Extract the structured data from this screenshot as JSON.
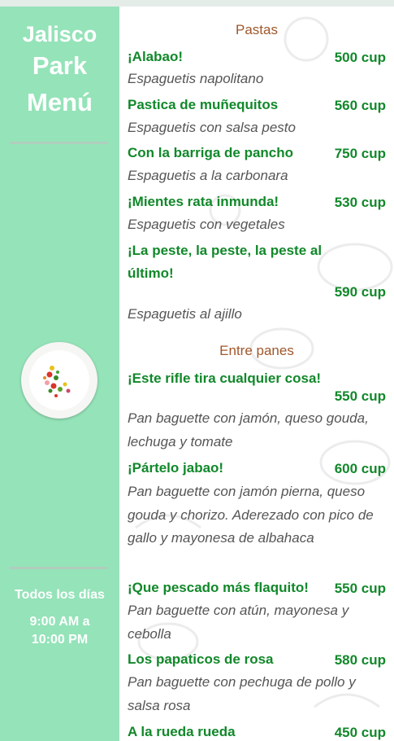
{
  "sidebar": {
    "brand_line1": "Jalisco",
    "brand_line2": "Park",
    "brand_line3": "Menú",
    "days": "Todos los días",
    "time_open": "9:00 AM a",
    "time_close": "10:00 PM"
  },
  "sections": [
    {
      "title": "Pastas",
      "items": [
        {
          "name": "¡Alabao!",
          "price": "500 cup",
          "desc": "Espaguetis napolitano"
        },
        {
          "name": "Pastica de muñequitos",
          "price": "560 cup",
          "desc": "Espaguetis con salsa pesto"
        },
        {
          "name": "Con la barriga de pancho",
          "price": "750 cup",
          "desc": "Espaguetis a la carbonara"
        },
        {
          "name": "¡Mientes rata inmunda!",
          "price": "530 cup",
          "desc": "Espaguetis con vegetales"
        },
        {
          "name": "¡La peste, la peste, la peste al último!",
          "price": "590 cup",
          "desc": "Espaguetis al ajillo"
        }
      ]
    },
    {
      "title": "Entre panes",
      "items": [
        {
          "name": "¡Este rifle tira cualquier cosa!",
          "price": "550 cup",
          "desc": "Pan baguette con jamón, queso gouda, lechuga y tomate"
        },
        {
          "name": "¡Pártelo jabao!",
          "price": "600 cup",
          "desc": "Pan baguette con jamón pierna, queso gouda y chorizo. Aderezado con pico de gallo y mayonesa de albahaca"
        },
        {
          "name": "¡Que pescado más flaquito!",
          "price": "550 cup",
          "desc": "Pan baguette con atún, mayonesa y cebolla"
        },
        {
          "name": "Los papaticos de rosa",
          "price": "580 cup",
          "desc": "Pan baguette con pechuga de pollo y salsa rosa"
        },
        {
          "name": "A la rueda rueda",
          "price": "450 cup",
          "desc": ""
        }
      ]
    }
  ]
}
